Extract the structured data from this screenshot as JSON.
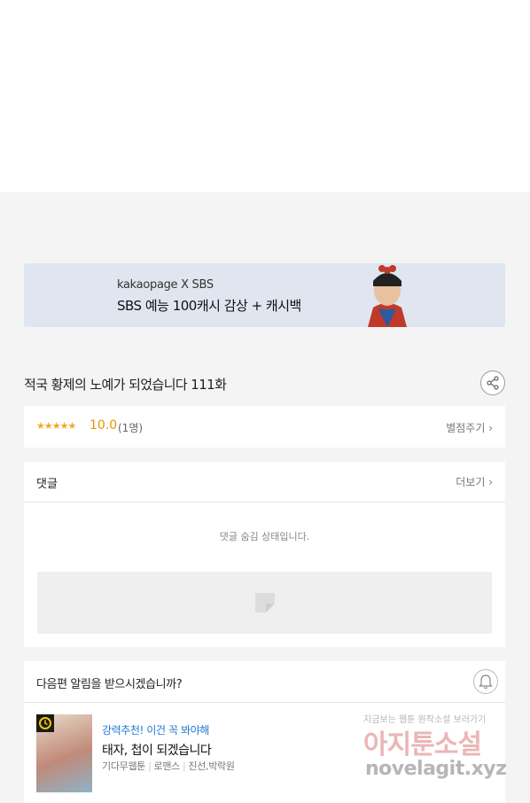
{
  "banner": {
    "line1": "kakaopage X SBS",
    "line2": "SBS 예능 100캐시 감상 + 캐시백"
  },
  "episode": {
    "title": "적국 황제의 노예가 되었습니다 111화"
  },
  "rating": {
    "stars": "★★★★★",
    "score": "10.0",
    "count": "(1명)",
    "rate_link": "별점주기 ›"
  },
  "comments": {
    "label": "댓글",
    "more": "더보기 ›",
    "hidden_message": "댓글 숨김 상태입니다."
  },
  "notify": {
    "question": "다음편 알림을 받으시겠습니까?",
    "recommendation": {
      "kicker": "강력추천! 이건 꼭 봐야해",
      "title": "태자, 첩이 되겠습니다",
      "genre": "기다무웹툰",
      "category": "로맨스",
      "authors": "진선,박락원"
    }
  },
  "watermark": {
    "line1": "지금보는 웹툰 원작소설 보러가기",
    "line2": "아지툰소설",
    "line3": "novelagit.xyz"
  }
}
